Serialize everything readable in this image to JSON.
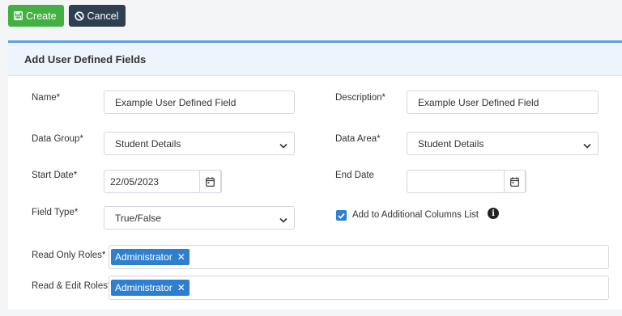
{
  "toolbar": {
    "create_label": "Create",
    "cancel_label": "Cancel"
  },
  "panel": {
    "title": "Add User Defined Fields"
  },
  "form": {
    "name": {
      "label": "Name*",
      "value": "Example User Defined Field"
    },
    "description": {
      "label": "Description*",
      "value": "Example User Defined Field"
    },
    "data_group": {
      "label": "Data Group*",
      "value": "Student Details"
    },
    "data_area": {
      "label": "Data Area*",
      "value": "Student Details"
    },
    "start_date": {
      "label": "Start Date*",
      "value": "22/05/2023"
    },
    "end_date": {
      "label": "End Date",
      "value": ""
    },
    "field_type": {
      "label": "Field Type*",
      "value": "True/False"
    },
    "additional_columns": {
      "label": "Add to Additional Columns List",
      "checked": true,
      "info_glyph": "i"
    },
    "read_only_roles": {
      "label": "Read Only Roles*",
      "tags": [
        "Administrator"
      ]
    },
    "read_edit_roles": {
      "label": "Read & Edit Roles*",
      "tags": [
        "Administrator"
      ]
    }
  },
  "icons": {
    "create": "save-icon",
    "cancel": "ban-icon",
    "dropdown": "chevron-down-icon",
    "calendar": "calendar-icon",
    "remove_tag": "x",
    "info": "info-circle-icon"
  },
  "colors": {
    "create": "#43b043",
    "cancel": "#2e3f4f",
    "accent": "#2f7fd0",
    "panel_border": "#5aa0e6"
  }
}
